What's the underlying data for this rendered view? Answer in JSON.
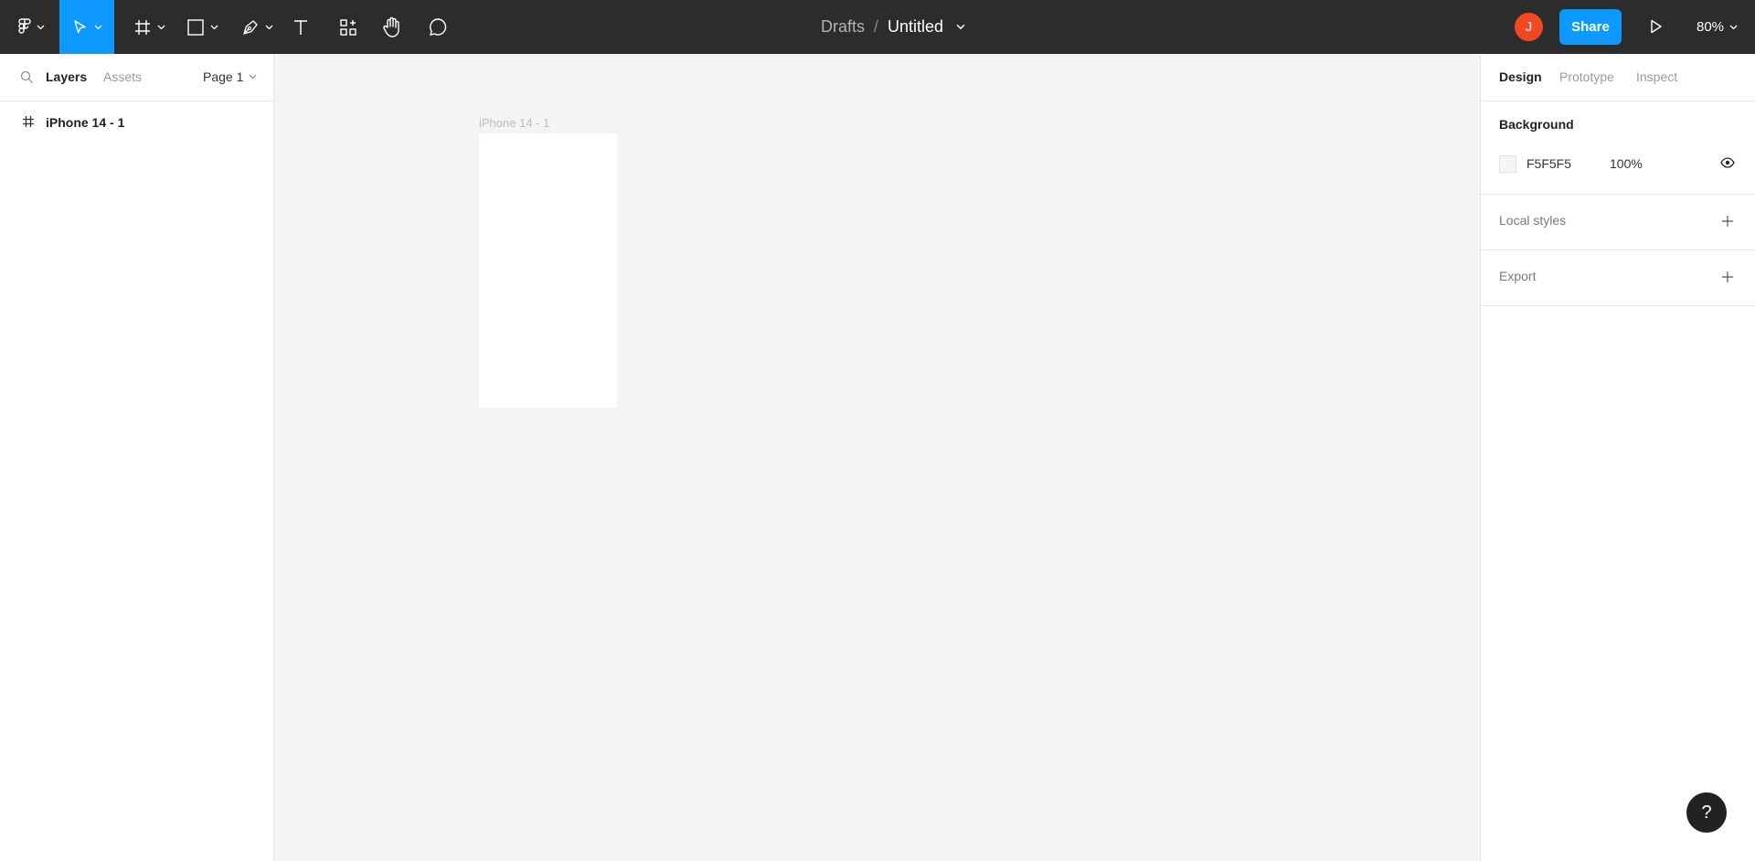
{
  "toolbar": {
    "breadcrumb_root": "Drafts",
    "separator": "/",
    "document_title": "Untitled",
    "user_initial": "J",
    "share_label": "Share",
    "zoom": "80%",
    "accent_color": "#0d99ff"
  },
  "left_panel": {
    "tabs": [
      {
        "label": "Layers",
        "active": true
      },
      {
        "label": "Assets",
        "active": false
      }
    ],
    "page": "Page 1",
    "layers": [
      {
        "name": "iPhone 14 - 1",
        "icon": "frame-icon"
      }
    ]
  },
  "canvas": {
    "frame_label": "iPhone 14 - 1"
  },
  "right_panel": {
    "tabs": [
      {
        "label": "Design",
        "active": true
      },
      {
        "label": "Prototype",
        "active": false
      },
      {
        "label": "Inspect",
        "active": false
      }
    ],
    "background": {
      "heading": "Background",
      "hex": "F5F5F5",
      "opacity": "100%"
    },
    "local_styles": "Local styles",
    "export": "Export"
  },
  "help": "?"
}
